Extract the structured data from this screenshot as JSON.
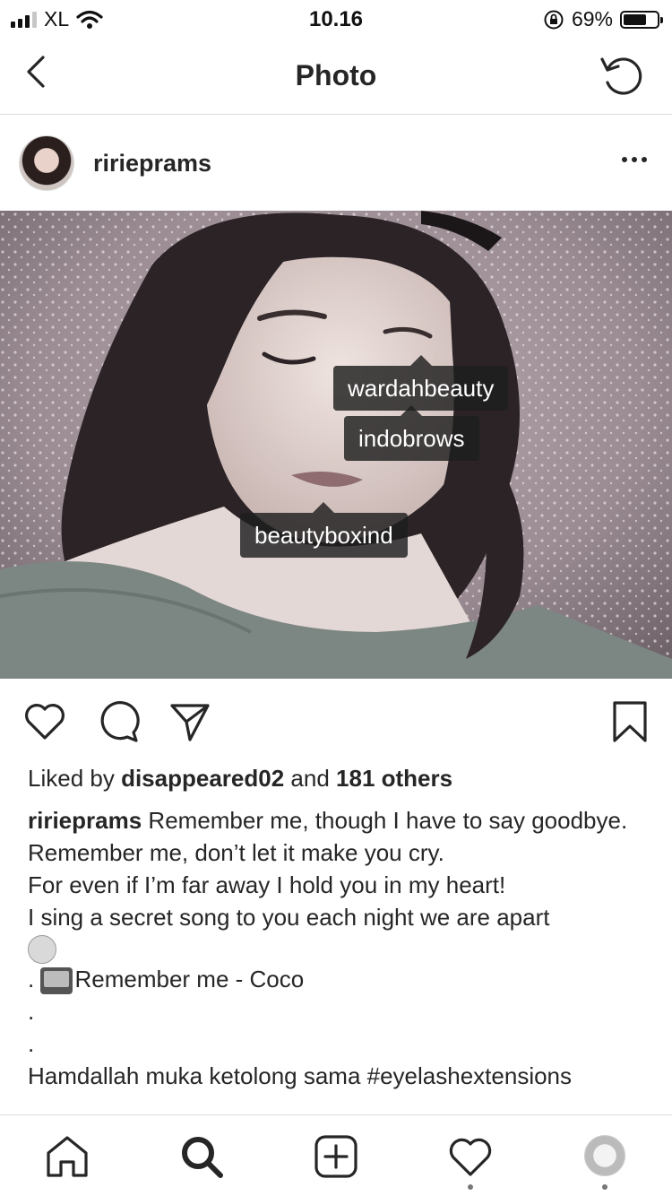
{
  "status_bar": {
    "carrier": "XL",
    "time": "10.16",
    "battery_percent": "69%",
    "battery_level": 0.69,
    "icons": [
      "signal-icon",
      "wifi-icon",
      "orientation-lock-icon",
      "battery-icon"
    ]
  },
  "nav": {
    "title": "Photo",
    "back_icon": "chevron-left-icon",
    "refresh_icon": "refresh-icon"
  },
  "post": {
    "username": "ririeprams",
    "more_icon": "more-horizontal-icon",
    "tags": [
      "wardahbeauty",
      "indobrows",
      "beautyboxind"
    ],
    "likes": {
      "prefix": "Liked by",
      "user": "disappeared02",
      "middle": "and",
      "others": "181 others"
    },
    "caption": {
      "username": "ririeprams",
      "line1": "Remember me, though I have to say goodbye.",
      "line2": "Remember me, don’t let it make you cry.",
      "line3": "For even if I’m far away I hold you in my heart!",
      "line4": "I sing a secret song to you each night we are apart",
      "line5_prefix": ".",
      "line5_text": "Remember me - Coco",
      "dot1": ".",
      "dot2": ".",
      "line6": "Hamdallah muka ketolong sama #eyelashextensions"
    }
  },
  "action_icons": [
    "heart-icon",
    "comment-icon",
    "share-icon",
    "bookmark-icon"
  ],
  "tabbar": {
    "items": [
      "home-icon",
      "search-icon",
      "add-post-icon",
      "activity-icon",
      "profile-avatar"
    ]
  },
  "colors": {
    "text": "#262626",
    "divider": "#dbdbdb",
    "tag_bg": "#1e1e1e"
  }
}
